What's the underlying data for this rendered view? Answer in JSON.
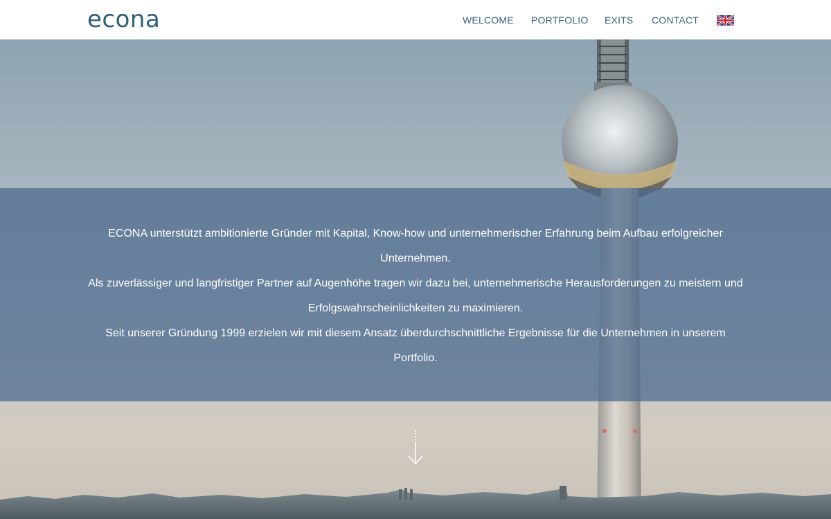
{
  "header": {
    "logo": "econa",
    "nav": {
      "welcome": "WELCOME",
      "portfolio": "PORTFOLIO",
      "exits": "EXITS",
      "contact": "CONTACT"
    },
    "language_icon": "uk-flag-icon"
  },
  "intro": {
    "paragraphs": [
      "ECONA unterstützt ambitionierte Gründer mit Kapital, Know-how und unternehmerischer Erfahrung beim Aufbau erfolgreicher Unternehmen.",
      "Als zuverlässiger und langfristiger Partner auf Augenhöhe tragen wir dazu bei, unternehmerische Herausforderungen zu meistern und Erfolgswahrscheinlichkeiten zu maximieren.",
      "Seit unserer Gründung 1999 erzielen wir mit diesem Ansatz überdurchschnittliche Ergebnisse für die Unternehmen in unserem Portfolio."
    ]
  },
  "scroll_icon": "arrow-down-icon",
  "colors": {
    "brand": "#2d5d7a",
    "nav_text": "#3c5f7c",
    "overlay": "#4a688c"
  }
}
